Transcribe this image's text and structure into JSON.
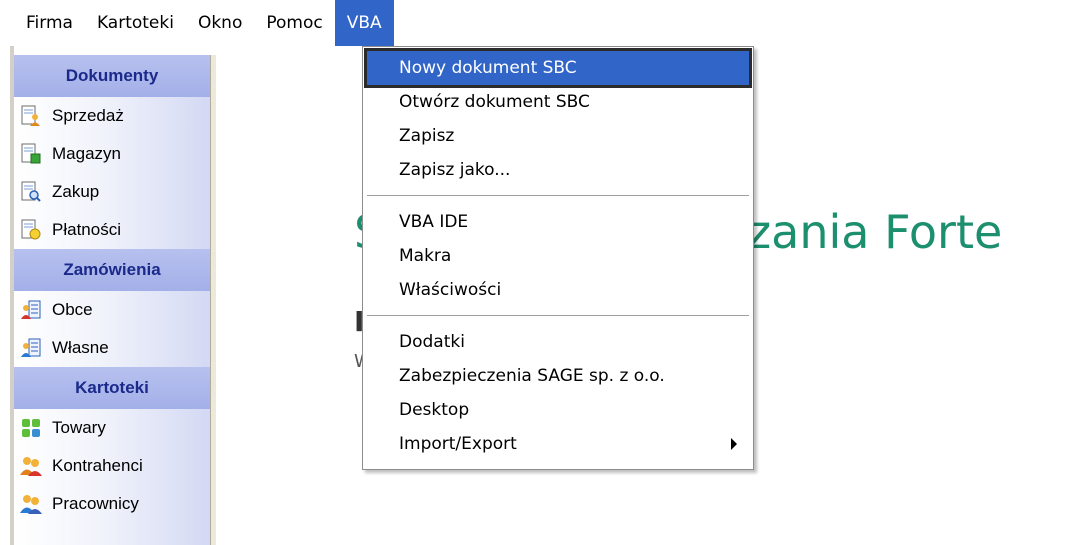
{
  "menubar": {
    "items": [
      {
        "label": "Firma"
      },
      {
        "label": "Kartoteki"
      },
      {
        "label": "Okno"
      },
      {
        "label": "Pomoc"
      },
      {
        "label": "VBA"
      }
    ]
  },
  "sidebar": {
    "groups": [
      {
        "title": "Dokumenty",
        "items": [
          {
            "label": "Sprzedaż",
            "icon": "document-person-icon"
          },
          {
            "label": "Magazyn",
            "icon": "document-box-icon"
          },
          {
            "label": "Zakup",
            "icon": "document-search-icon"
          },
          {
            "label": "Płatności",
            "icon": "document-coin-icon"
          }
        ]
      },
      {
        "title": "Zamówienia",
        "items": [
          {
            "label": "Obce",
            "icon": "order-list-icon"
          },
          {
            "label": "Własne",
            "icon": "order-list-icon"
          }
        ]
      },
      {
        "title": "Kartoteki",
        "items": [
          {
            "label": "Towary",
            "icon": "goods-icon"
          },
          {
            "label": "Kontrahenci",
            "icon": "contractors-icon"
          },
          {
            "label": "Pracownicy",
            "icon": "employees-icon"
          }
        ]
      }
    ]
  },
  "content": {
    "title_fragment_left": "S",
    "title_fragment_right": "zania Forte",
    "subtitle_fragment": "I",
    "line_fragment": "W"
  },
  "dropdown": {
    "section1": [
      {
        "label": "Nowy dokument SBC"
      },
      {
        "label": "Otwórz dokument SBC"
      },
      {
        "label": "Zapisz"
      },
      {
        "label": "Zapisz jako..."
      }
    ],
    "section2": [
      {
        "label": "VBA IDE"
      },
      {
        "label": "Makra"
      },
      {
        "label": "Właściwości"
      }
    ],
    "section3": [
      {
        "label": "Dodatki"
      },
      {
        "label": "Zabezpieczenia SAGE sp. z o.o."
      },
      {
        "label": "Desktop"
      },
      {
        "label": "Import/Export"
      }
    ]
  },
  "colors": {
    "menu_highlight": "#3165c8",
    "sidebar_header": "#a3afe8",
    "sidebar_header_text": "#1b2a8a",
    "title_green": "#1c8f6e"
  }
}
